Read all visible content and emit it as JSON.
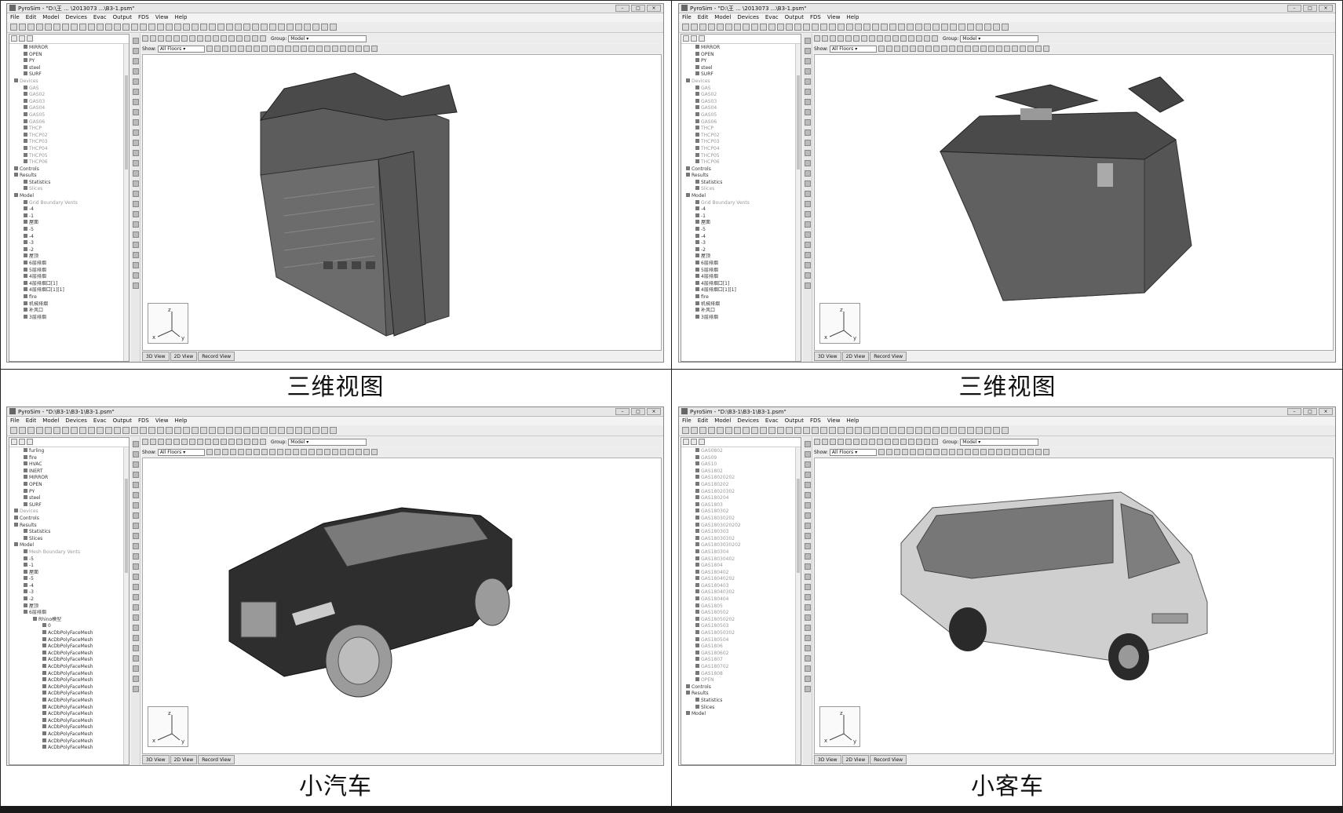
{
  "app": {
    "titles": [
      "PyroSim - \"D:\\王 ... \\2013073 ...\\B3-1.psm\"",
      "PyroSim - \"D:\\王 ... \\2013073 ...\\B3-1.psm\"",
      "PyroSim - \"D:\\B3-1\\B3-1\\B3-1.psm\"",
      "PyroSim - \"D:\\B3-1\\B3-1\\B3-1.psm\""
    ],
    "menu": [
      "File",
      "Edit",
      "Model",
      "Devices",
      "Evac",
      "Output",
      "FDS",
      "View",
      "Help"
    ],
    "group_label": "Group:",
    "group_value": "Model",
    "show_label": "Show:",
    "floors_value": "All Floors",
    "tabs": [
      "3D View",
      "2D View",
      "Record View"
    ]
  },
  "captions": [
    "三维视图",
    "三维视图",
    "小汽车",
    "小客车"
  ],
  "trees": [
    {
      "items": [
        {
          "level": 2,
          "text": "MIRROR"
        },
        {
          "level": 2,
          "text": "OPEN"
        },
        {
          "level": 2,
          "text": "PY"
        },
        {
          "level": 2,
          "text": "steel"
        },
        {
          "level": 2,
          "text": "SURF"
        },
        {
          "level": 1,
          "text": "Devices",
          "dim": true
        },
        {
          "level": 2,
          "text": "GAS",
          "dim": true
        },
        {
          "level": 2,
          "text": "GAS02",
          "dim": true
        },
        {
          "level": 2,
          "text": "GAS03",
          "dim": true
        },
        {
          "level": 2,
          "text": "GAS04",
          "dim": true
        },
        {
          "level": 2,
          "text": "GAS05",
          "dim": true
        },
        {
          "level": 2,
          "text": "GAS06",
          "dim": true
        },
        {
          "level": 2,
          "text": "THCP",
          "dim": true
        },
        {
          "level": 2,
          "text": "THCP02",
          "dim": true
        },
        {
          "level": 2,
          "text": "THCP03",
          "dim": true
        },
        {
          "level": 2,
          "text": "THCP04",
          "dim": true
        },
        {
          "level": 2,
          "text": "THCP05",
          "dim": true
        },
        {
          "level": 2,
          "text": "THCP06",
          "dim": true
        },
        {
          "level": 1,
          "text": "Controls"
        },
        {
          "level": 1,
          "text": "Results"
        },
        {
          "level": 2,
          "text": "Statistics"
        },
        {
          "level": 2,
          "text": "Slices",
          "dim": true
        },
        {
          "level": 1,
          "text": "Model"
        },
        {
          "level": 2,
          "text": "Grid Boundary Vents",
          "dim": true
        },
        {
          "level": 2,
          "text": "-4"
        },
        {
          "level": 2,
          "text": "-1"
        },
        {
          "level": 2,
          "text": "屋面"
        },
        {
          "level": 2,
          "text": "-5"
        },
        {
          "level": 2,
          "text": "-4"
        },
        {
          "level": 2,
          "text": "-3"
        },
        {
          "level": 2,
          "text": "-2"
        },
        {
          "level": 2,
          "text": "屋顶"
        },
        {
          "level": 2,
          "text": "6层排烟"
        },
        {
          "level": 2,
          "text": "5层排烟"
        },
        {
          "level": 2,
          "text": "4层排烟"
        },
        {
          "level": 2,
          "text": "4层排烟口[1]"
        },
        {
          "level": 2,
          "text": "4层排烟口[1][1]"
        },
        {
          "level": 2,
          "text": "fire"
        },
        {
          "level": 2,
          "text": "机械排烟"
        },
        {
          "level": 2,
          "text": "补风口"
        },
        {
          "level": 2,
          "text": "3层排烟"
        }
      ]
    },
    {
      "items": [
        {
          "level": 2,
          "text": "MIRROR"
        },
        {
          "level": 2,
          "text": "OPEN"
        },
        {
          "level": 2,
          "text": "PY"
        },
        {
          "level": 2,
          "text": "steel"
        },
        {
          "level": 2,
          "text": "SURF"
        },
        {
          "level": 1,
          "text": "Devices",
          "dim": true
        },
        {
          "level": 2,
          "text": "GAS",
          "dim": true
        },
        {
          "level": 2,
          "text": "GAS02",
          "dim": true
        },
        {
          "level": 2,
          "text": "GAS03",
          "dim": true
        },
        {
          "level": 2,
          "text": "GAS04",
          "dim": true
        },
        {
          "level": 2,
          "text": "GAS05",
          "dim": true
        },
        {
          "level": 2,
          "text": "GAS06",
          "dim": true
        },
        {
          "level": 2,
          "text": "THCP",
          "dim": true
        },
        {
          "level": 2,
          "text": "THCP02",
          "dim": true
        },
        {
          "level": 2,
          "text": "THCP03",
          "dim": true
        },
        {
          "level": 2,
          "text": "THCP04",
          "dim": true
        },
        {
          "level": 2,
          "text": "THCP05",
          "dim": true
        },
        {
          "level": 2,
          "text": "THCP06",
          "dim": true
        },
        {
          "level": 1,
          "text": "Controls"
        },
        {
          "level": 1,
          "text": "Results"
        },
        {
          "level": 2,
          "text": "Statistics"
        },
        {
          "level": 2,
          "text": "Slices",
          "dim": true
        },
        {
          "level": 1,
          "text": "Model"
        },
        {
          "level": 2,
          "text": "Grid Boundary Vents",
          "dim": true
        },
        {
          "level": 2,
          "text": "-4"
        },
        {
          "level": 2,
          "text": "-1"
        },
        {
          "level": 2,
          "text": "屋面"
        },
        {
          "level": 2,
          "text": "-5"
        },
        {
          "level": 2,
          "text": "-4"
        },
        {
          "level": 2,
          "text": "-3"
        },
        {
          "level": 2,
          "text": "-2"
        },
        {
          "level": 2,
          "text": "屋顶"
        },
        {
          "level": 2,
          "text": "6层排烟"
        },
        {
          "level": 2,
          "text": "5层排烟"
        },
        {
          "level": 2,
          "text": "4层排烟"
        },
        {
          "level": 2,
          "text": "4层排烟口[1]"
        },
        {
          "level": 2,
          "text": "4层排烟口[1][1]"
        },
        {
          "level": 2,
          "text": "fire"
        },
        {
          "level": 2,
          "text": "机械排烟"
        },
        {
          "level": 2,
          "text": "补风口"
        },
        {
          "level": 2,
          "text": "3层排烟"
        }
      ]
    },
    {
      "items": [
        {
          "level": 2,
          "text": "furling"
        },
        {
          "level": 2,
          "text": "fire"
        },
        {
          "level": 2,
          "text": "HVAC"
        },
        {
          "level": 2,
          "text": "INERT"
        },
        {
          "level": 2,
          "text": "MIRROR"
        },
        {
          "level": 2,
          "text": "OPEN"
        },
        {
          "level": 2,
          "text": "PY"
        },
        {
          "level": 2,
          "text": "steel"
        },
        {
          "level": 2,
          "text": "SURF"
        },
        {
          "level": 1,
          "text": "Devices",
          "dim": true
        },
        {
          "level": 1,
          "text": "Controls"
        },
        {
          "level": 1,
          "text": "Results"
        },
        {
          "level": 2,
          "text": "Statistics"
        },
        {
          "level": 2,
          "text": "Slices"
        },
        {
          "level": 1,
          "text": "Model"
        },
        {
          "level": 2,
          "text": "Mesh Boundary Vents",
          "dim": true
        },
        {
          "level": 2,
          "text": "-5"
        },
        {
          "level": 2,
          "text": "-1"
        },
        {
          "level": 2,
          "text": "屋面"
        },
        {
          "level": 2,
          "text": "-5"
        },
        {
          "level": 2,
          "text": "-4"
        },
        {
          "level": 2,
          "text": "-3"
        },
        {
          "level": 2,
          "text": "-2"
        },
        {
          "level": 2,
          "text": "屋顶"
        },
        {
          "level": 2,
          "text": "6层排烟"
        },
        {
          "level": 3,
          "text": "Rhino模型"
        },
        {
          "level": 4,
          "text": "0"
        },
        {
          "level": 4,
          "text": "AcDbPolyFaceMesh"
        },
        {
          "level": 4,
          "text": "AcDbPolyFaceMesh"
        },
        {
          "level": 4,
          "text": "AcDbPolyFaceMesh"
        },
        {
          "level": 4,
          "text": "AcDbPolyFaceMesh"
        },
        {
          "level": 4,
          "text": "AcDbPolyFaceMesh"
        },
        {
          "level": 4,
          "text": "AcDbPolyFaceMesh"
        },
        {
          "level": 4,
          "text": "AcDbPolyFaceMesh"
        },
        {
          "level": 4,
          "text": "AcDbPolyFaceMesh"
        },
        {
          "level": 4,
          "text": "AcDbPolyFaceMesh"
        },
        {
          "level": 4,
          "text": "AcDbPolyFaceMesh"
        },
        {
          "level": 4,
          "text": "AcDbPolyFaceMesh"
        },
        {
          "level": 4,
          "text": "AcDbPolyFaceMesh"
        },
        {
          "level": 4,
          "text": "AcDbPolyFaceMesh"
        },
        {
          "level": 4,
          "text": "AcDbPolyFaceMesh"
        },
        {
          "level": 4,
          "text": "AcDbPolyFaceMesh"
        },
        {
          "level": 4,
          "text": "AcDbPolyFaceMesh"
        },
        {
          "level": 4,
          "text": "AcDbPolyFaceMesh"
        },
        {
          "level": 4,
          "text": "AcDbPolyFaceMesh"
        }
      ]
    },
    {
      "items": [
        {
          "level": 2,
          "text": "GAS0802",
          "dim": true
        },
        {
          "level": 2,
          "text": "GAS09",
          "dim": true
        },
        {
          "level": 2,
          "text": "GAS10",
          "dim": true
        },
        {
          "level": 2,
          "text": "GAS1802",
          "dim": true
        },
        {
          "level": 2,
          "text": "GAS18020202",
          "dim": true
        },
        {
          "level": 2,
          "text": "GAS180202",
          "dim": true
        },
        {
          "level": 2,
          "text": "GAS18020302",
          "dim": true
        },
        {
          "level": 2,
          "text": "GAS180204",
          "dim": true
        },
        {
          "level": 2,
          "text": "GAS1803",
          "dim": true
        },
        {
          "level": 2,
          "text": "GAS180302",
          "dim": true
        },
        {
          "level": 2,
          "text": "GAS18030202",
          "dim": true
        },
        {
          "level": 2,
          "text": "GAS1803020202",
          "dim": true
        },
        {
          "level": 2,
          "text": "GAS180303",
          "dim": true
        },
        {
          "level": 2,
          "text": "GAS18030302",
          "dim": true
        },
        {
          "level": 2,
          "text": "GAS1803030202",
          "dim": true
        },
        {
          "level": 2,
          "text": "GAS180304",
          "dim": true
        },
        {
          "level": 2,
          "text": "GAS18030402",
          "dim": true
        },
        {
          "level": 2,
          "text": "GAS1804",
          "dim": true
        },
        {
          "level": 2,
          "text": "GAS180402",
          "dim": true
        },
        {
          "level": 2,
          "text": "GAS18040202",
          "dim": true
        },
        {
          "level": 2,
          "text": "GAS180403",
          "dim": true
        },
        {
          "level": 2,
          "text": "GAS18040302",
          "dim": true
        },
        {
          "level": 2,
          "text": "GAS180404",
          "dim": true
        },
        {
          "level": 2,
          "text": "GAS1805",
          "dim": true
        },
        {
          "level": 2,
          "text": "GAS180502",
          "dim": true
        },
        {
          "level": 2,
          "text": "GAS18050202",
          "dim": true
        },
        {
          "level": 2,
          "text": "GAS180503",
          "dim": true
        },
        {
          "level": 2,
          "text": "GAS18050302",
          "dim": true
        },
        {
          "level": 2,
          "text": "GAS180504",
          "dim": true
        },
        {
          "level": 2,
          "text": "GAS1806",
          "dim": true
        },
        {
          "level": 2,
          "text": "GAS180602",
          "dim": true
        },
        {
          "level": 2,
          "text": "GAS1807",
          "dim": true
        },
        {
          "level": 2,
          "text": "GAS180702",
          "dim": true
        },
        {
          "level": 2,
          "text": "GAS1808",
          "dim": true
        },
        {
          "level": 2,
          "text": "OPEN",
          "dim": true
        },
        {
          "level": 1,
          "text": "Controls"
        },
        {
          "level": 1,
          "text": "Results"
        },
        {
          "level": 2,
          "text": "Statistics"
        },
        {
          "level": 2,
          "text": "Slices"
        },
        {
          "level": 1,
          "text": "Model"
        }
      ]
    }
  ]
}
